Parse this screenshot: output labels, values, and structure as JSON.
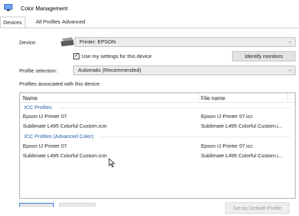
{
  "window": {
    "title": "Color Management"
  },
  "tabs": [
    {
      "label": "Devices"
    },
    {
      "label": "All Profiles"
    },
    {
      "label": "Advanced"
    }
  ],
  "device": {
    "label": "Device:",
    "selected": "Printer: EPSON",
    "use_settings_label": "Use my settings for this device",
    "use_settings_checked": true,
    "identify_button": "Identify monitors"
  },
  "profile_selection": {
    "label": "Profile selection:",
    "selected": "Automatic (Recommended)"
  },
  "profiles_list": {
    "caption": "Profiles associated with this device:",
    "columns": {
      "name": "Name",
      "file": "File name"
    },
    "groups": [
      {
        "title": "ICC Profiles",
        "rows": [
          {
            "name": "Epson IJ Printer 07",
            "file": "Epson IJ Printer 07.icc"
          },
          {
            "name": "Sublimate L495 Colorful Custom.icm",
            "file": "Sublimate L495 Colorful Custom.i..."
          }
        ]
      },
      {
        "title": "ICC Profiles (Advanced Color)",
        "rows": [
          {
            "name": "Epson IJ Printer 07",
            "file": "Epson IJ Printer 07.icc"
          },
          {
            "name": "Sublimate L495 Colorful Custom.icm",
            "file": "Sublimate L495 Colorful Custom.i..."
          }
        ]
      }
    ]
  },
  "footer": {
    "set_default_button": "Set as Default Profile"
  }
}
